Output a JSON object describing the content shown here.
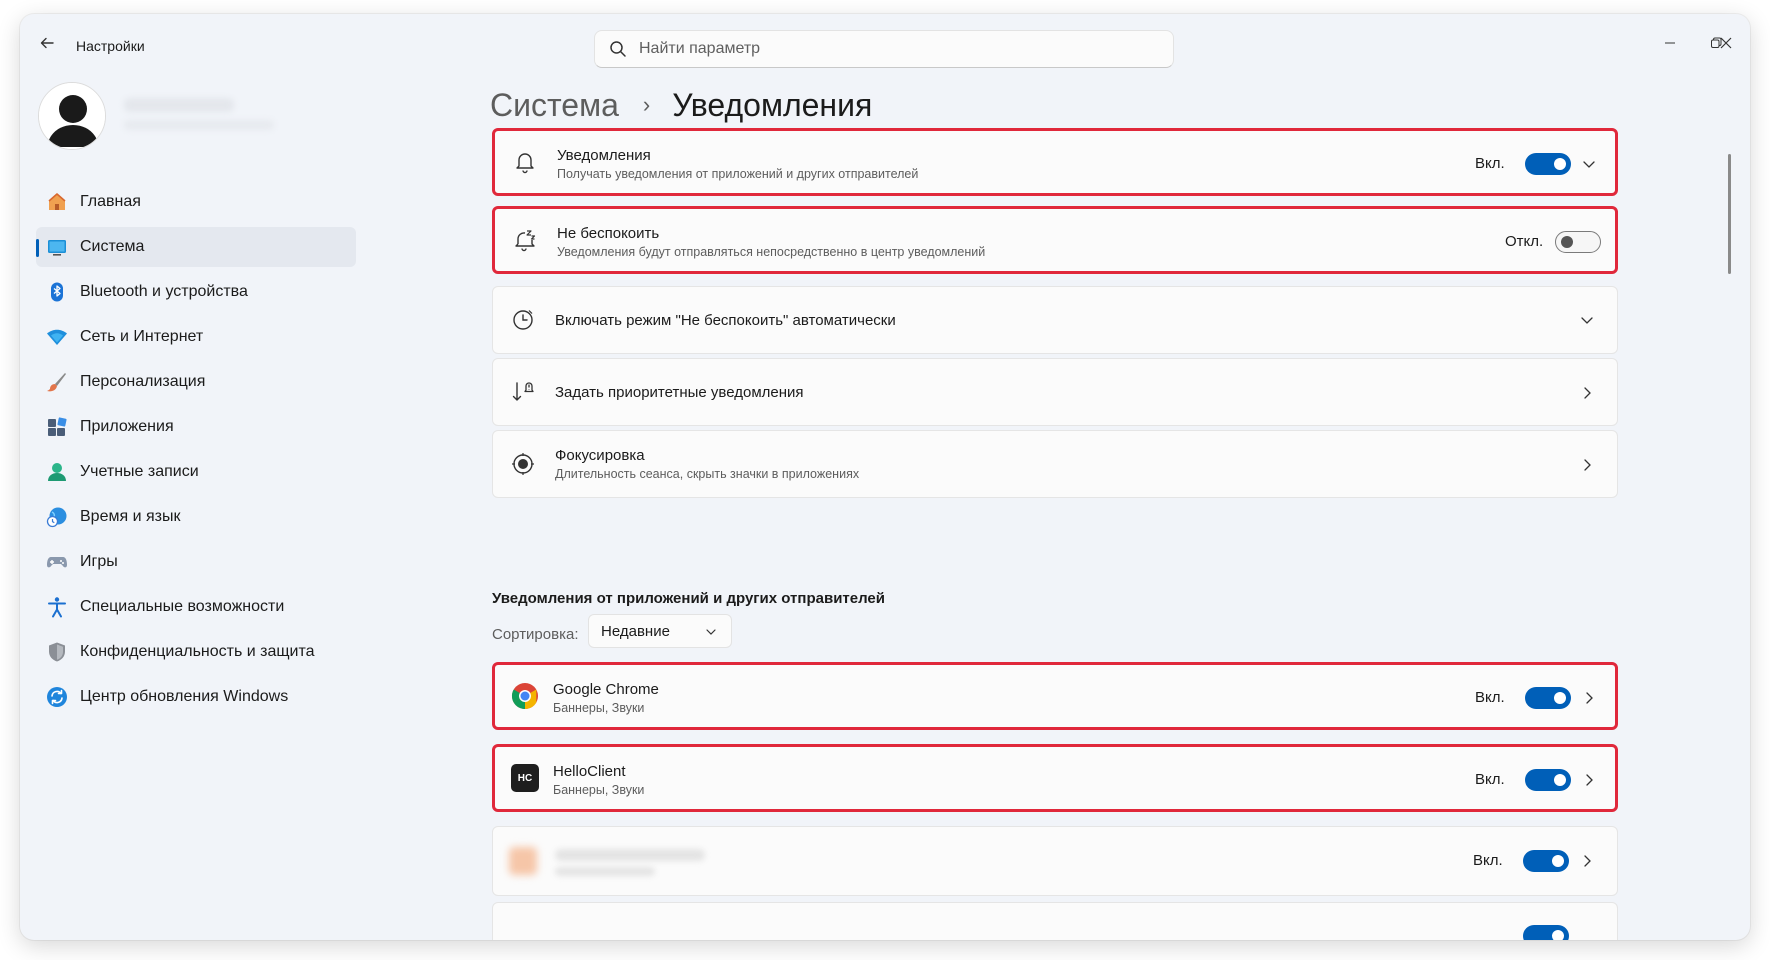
{
  "window": {
    "title": "Настройки"
  },
  "search": {
    "placeholder": "Найти параметр"
  },
  "sidebar": {
    "items": [
      {
        "label": "Главная",
        "icon": "home-icon"
      },
      {
        "label": "Система",
        "icon": "system-icon",
        "active": true
      },
      {
        "label": "Bluetooth и устройства",
        "icon": "bluetooth-icon"
      },
      {
        "label": "Сеть и Интернет",
        "icon": "network-icon"
      },
      {
        "label": "Персонализация",
        "icon": "brush-icon"
      },
      {
        "label": "Приложения",
        "icon": "apps-icon"
      },
      {
        "label": "Учетные записи",
        "icon": "user-icon"
      },
      {
        "label": "Время и язык",
        "icon": "globe-clock-icon"
      },
      {
        "label": "Игры",
        "icon": "gamepad-icon"
      },
      {
        "label": "Специальные возможности",
        "icon": "accessibility-icon"
      },
      {
        "label": "Конфиденциальность и защита",
        "icon": "shield-icon"
      },
      {
        "label": "Центр обновления Windows",
        "icon": "update-icon"
      }
    ]
  },
  "breadcrumb": {
    "parent": "Система",
    "separator": "›",
    "current": "Уведомления"
  },
  "settings": {
    "notifications": {
      "title": "Уведомления",
      "subtitle": "Получать уведомления от приложений и других отправителей",
      "state": "Вкл.",
      "on": true
    },
    "dnd": {
      "title": "Не беспокоить",
      "subtitle": "Уведомления будут отправляться непосредственно в центр уведомлений",
      "state": "Откл.",
      "on": false
    },
    "dnd_auto": {
      "title": "Включать режим \"Не беспокоить\" автоматически"
    },
    "priority": {
      "title": "Задать приоритетные уведомления"
    },
    "focus": {
      "title": "Фокусировка",
      "subtitle": "Длительность сеанса, скрыть значки в приложениях"
    }
  },
  "apps_section": {
    "title": "Уведомления от приложений и других отправителей",
    "sort_label": "Сортировка:",
    "sort_value": "Недавние",
    "apps": [
      {
        "name": "Google Chrome",
        "sub": "Баннеры, Звуки",
        "state": "Вкл.",
        "on": true,
        "icon": "chrome-icon"
      },
      {
        "name": "HelloClient",
        "sub": "Баннеры, Звуки",
        "state": "Вкл.",
        "on": true,
        "icon": "helloclient-icon",
        "icon_text": "HC"
      },
      {
        "name": "",
        "sub": "",
        "state": "Вкл.",
        "on": true,
        "icon": "blurred-app-icon"
      }
    ]
  },
  "colors": {
    "accent": "#005fb8",
    "highlight": "#e0283b",
    "window_bg": "#f1f4f9",
    "card_bg": "#fbfbfb"
  }
}
